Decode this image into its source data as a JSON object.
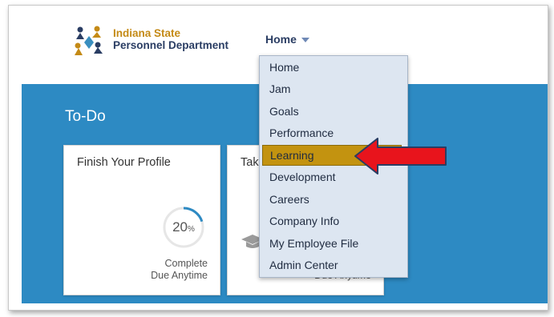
{
  "header": {
    "logo_line1": "Indiana State",
    "logo_line2": "Personnel Department",
    "nav_label": "Home"
  },
  "hero": {
    "title": "To-Do"
  },
  "cards": [
    {
      "title": "Finish Your Profile",
      "progress_value": "20",
      "progress_unit": "%",
      "progress_fraction": 0.2,
      "status": "Complete",
      "due": "Due Anytime"
    },
    {
      "title_visible": "Tak",
      "due": "Due Anytime"
    }
  ],
  "menu": {
    "items": [
      {
        "label": "Home"
      },
      {
        "label": "Jam"
      },
      {
        "label": "Goals"
      },
      {
        "label": "Performance"
      },
      {
        "label": "Learning",
        "highlighted": true
      },
      {
        "label": "Development"
      },
      {
        "label": "Careers"
      },
      {
        "label": "Company Info"
      },
      {
        "label": "My Employee File"
      },
      {
        "label": "Admin Center"
      }
    ]
  },
  "colors": {
    "hero": "#2d8ac3",
    "menu_bg": "#dde6f1",
    "highlight": "#c39310",
    "annotation_arrow": "#e8141c",
    "logo_gold": "#c48a16",
    "logo_navy": "#2a3d63"
  }
}
